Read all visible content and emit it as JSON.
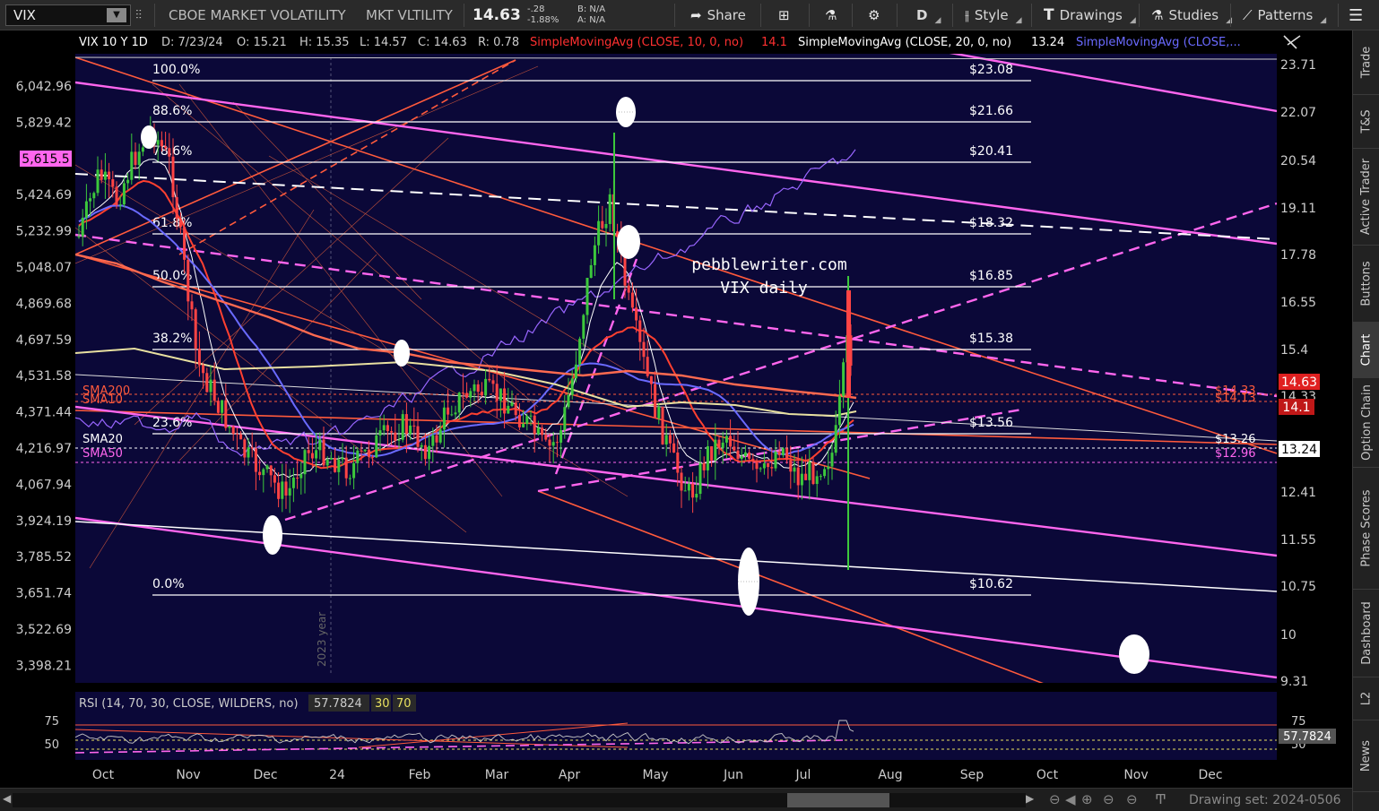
{
  "toolbar": {
    "symbol": "VIX",
    "description": "CBOE MARKET VOLATILITY",
    "short_name": "MKT VLTILITY",
    "last_price": "14.63",
    "net_change": "-.28",
    "pct_change": "-1.88%",
    "bid": "B: N/A",
    "ask": "A: N/A",
    "share_label": "Share",
    "interval_label": "D",
    "style_label": "Style",
    "drawings_label": "Drawings",
    "studies_label": "Studies",
    "patterns_label": "Patterns"
  },
  "chart_header": {
    "instrument": "VIX 10 Y 1D",
    "date": "D: 7/23/24",
    "open": "O: 15.21",
    "high": "H: 15.35",
    "low": "L: 14.57",
    "close": "C: 14.63",
    "range": "R: 0.78",
    "sma10_label": "SimpleMovingAvg (CLOSE, 10, 0, no)",
    "sma10_value": "14.1",
    "sma20_label": "SimpleMovingAvg (CLOSE, 20, 0, no)",
    "sma20_value": "13.24",
    "sma50_label": "SimpleMovingAvg (CLOSE,..."
  },
  "left_axis": [
    "6,042.96",
    "5,829.42",
    "5,615.5",
    "5,424.69",
    "5,232.99",
    "5,048.07",
    "4,869.68",
    "4,697.59",
    "4,531.58",
    "4,371.44",
    "4,216.97",
    "4,067.94",
    "3,924.19",
    "3,785.52",
    "3,651.74",
    "3,522.69",
    "3,398.21"
  ],
  "left_axis_highlight": "5,615.5",
  "right_axis": [
    "23.71",
    "22.07",
    "20.54",
    "19.11",
    "17.78",
    "16.55",
    "15.4",
    "14.33",
    "12.41",
    "11.55",
    "10.75",
    "10",
    "9.31"
  ],
  "price_tags": {
    "last": "14.63",
    "sma10": "14.1",
    "sma20": "13.24"
  },
  "fib_levels": [
    {
      "pct": "100.0%",
      "price": "$23.08"
    },
    {
      "pct": "88.6%",
      "price": "$21.66"
    },
    {
      "pct": "78.6%",
      "price": "$20.41"
    },
    {
      "pct": "61.8%",
      "price": "$18.32"
    },
    {
      "pct": "50.0%",
      "price": "$16.85"
    },
    {
      "pct": "38.2%",
      "price": "$15.38"
    },
    {
      "pct": "23.6%",
      "price": "$13.56"
    },
    {
      "pct": "0.0%",
      "price": "$10.62"
    }
  ],
  "line_labels": {
    "sma200": "SMA200",
    "sma10": "SMA10",
    "sma20": "SMA20",
    "sma50": "SMA50",
    "right_1433": "$14.33",
    "right_1413": "$14.13",
    "right_1326": "$13.26",
    "right_1296": "$12.96"
  },
  "watermark": {
    "line1": "pebblewriter.com",
    "line2": "VIX daily"
  },
  "year_label": "2023 year",
  "rsi": {
    "label": "RSI (14, 70, 30, CLOSE, WILDERS, no)",
    "value": "57.7824",
    "low": "30",
    "high": "70",
    "axis": [
      "75",
      "50"
    ]
  },
  "x_axis": [
    "Oct",
    "Nov",
    "Dec",
    "24",
    "Feb",
    "Mar",
    "Apr",
    "May",
    "Jun",
    "Jul",
    "Aug",
    "Sep",
    "Oct",
    "Nov",
    "Dec"
  ],
  "right_tabs": [
    "Trade",
    "T&S",
    "Active Trader",
    "Buttons",
    "Chart",
    "Option Chain",
    "Phase Scores",
    "Dashboard",
    "L2",
    "News"
  ],
  "active_tab": "Chart",
  "footer": {
    "drawing_set": "Drawing set: 2024-0506"
  },
  "colors": {
    "background": "#0b0838",
    "fib_line": "#ffffff",
    "magenta": "#ff66ff",
    "orange_red": "#ff5a3c",
    "purple": "#9966ff",
    "sma_blue": "#6a6aff",
    "sma_yellow": "#e8e0a0",
    "candle_up": "#3cc83c",
    "candle_down": "#ff4444"
  }
}
